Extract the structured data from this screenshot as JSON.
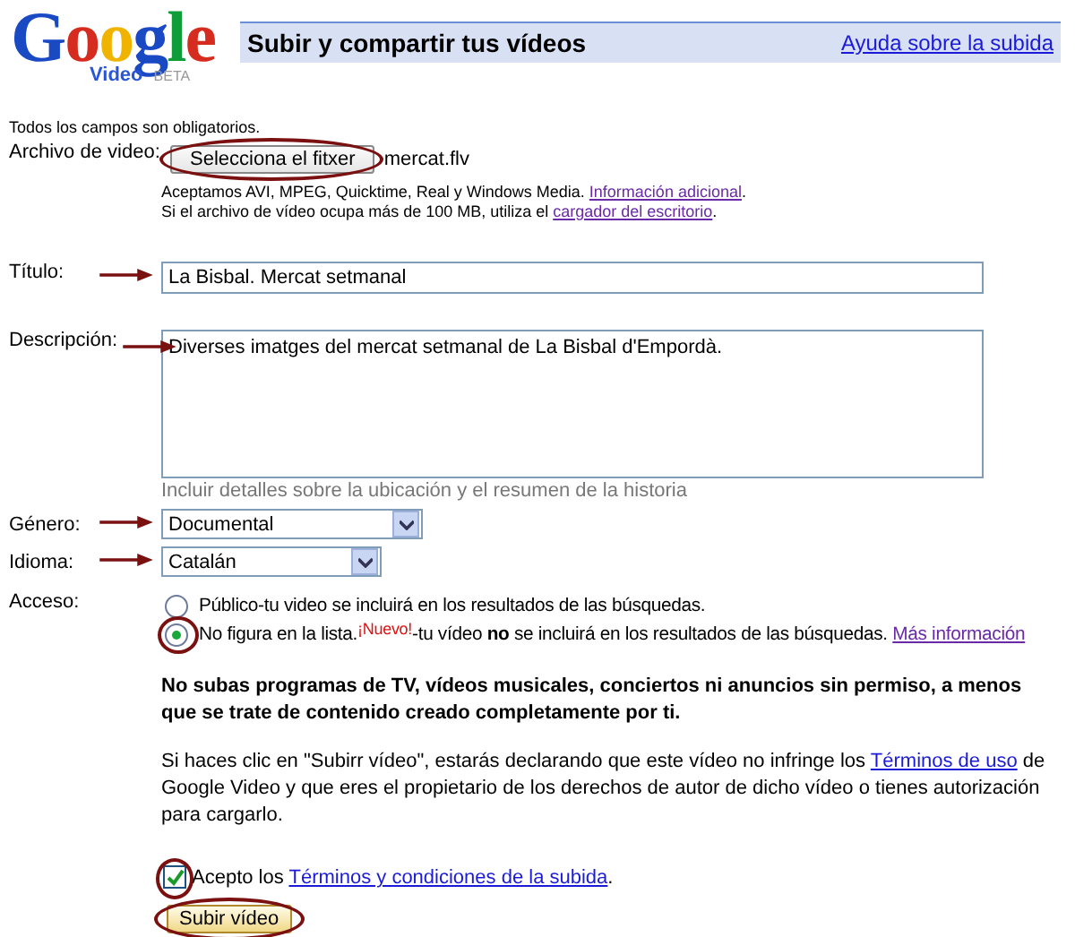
{
  "logo": {
    "wordmark": "Google",
    "product": "Video",
    "badge": "BETA"
  },
  "header": {
    "title": "Subir y compartir tus vídeos",
    "help_link": "Ayuda sobre la subida"
  },
  "required_note": "Todos los campos son obligatorios.",
  "file": {
    "label": "Archivo de video:",
    "button": "Selecciona el fitxer",
    "circled": true,
    "filename": "mercat.flv",
    "formats": {
      "before": "Aceptamos AVI, MPEG, Quicktime, Real y Windows Media.",
      "link": "Información adicional",
      "after": "."
    },
    "size": {
      "before": "Si el archivo de vídeo ocupa más de 100 MB, utiliza el",
      "link": "cargador del escritorio",
      "after": "."
    }
  },
  "title_field": {
    "label": "Título:",
    "value": "La Bisbal. Mercat setmanal",
    "arrow": true
  },
  "description_field": {
    "label": "Descripción:",
    "value": "Diverses imatges del mercat setmanal de La Bisbal d'Empordà.",
    "arrow": true,
    "hint": "Incluir detalles sobre la ubicación y el resumen de la historia"
  },
  "genre": {
    "label": "Género:",
    "value": "Documental",
    "arrow": true
  },
  "language": {
    "label": "Idioma:",
    "value": "Catalán",
    "arrow": true
  },
  "access": {
    "label": "Acceso:",
    "options": [
      {
        "label": "Público",
        "description": "-tu video se incluirá en los resultados de las búsquedas.",
        "selected": false
      },
      {
        "label": "No figura en la lista.",
        "badge": "¡Nuevo!",
        "description": "-tu vídeo **no** se incluirá en los resultados de las búsquedas.",
        "link": "Más información",
        "selected": true,
        "circled": true
      }
    ]
  },
  "warning": "No subas programas de TV, vídeos musicales, conciertos ni anuncios sin permiso, a menos que se trate de contenido creado completamente por ti.",
  "declaration": {
    "before": "Si haces clic en \"Subirr vídeo\", estarás declarando que este vídeo no infringe los",
    "link": "Términos de uso",
    "after": "de Google Video y que eres el propietario de los derechos de autor de dicho vídeo o tienes autorización para cargarlo."
  },
  "terms": {
    "before": "Acepto los",
    "link": "Términos y condiciones de la subida",
    "after": ".",
    "checked": true,
    "circled": true
  },
  "submit": {
    "label": "Subir vídeo",
    "circled": true
  }
}
